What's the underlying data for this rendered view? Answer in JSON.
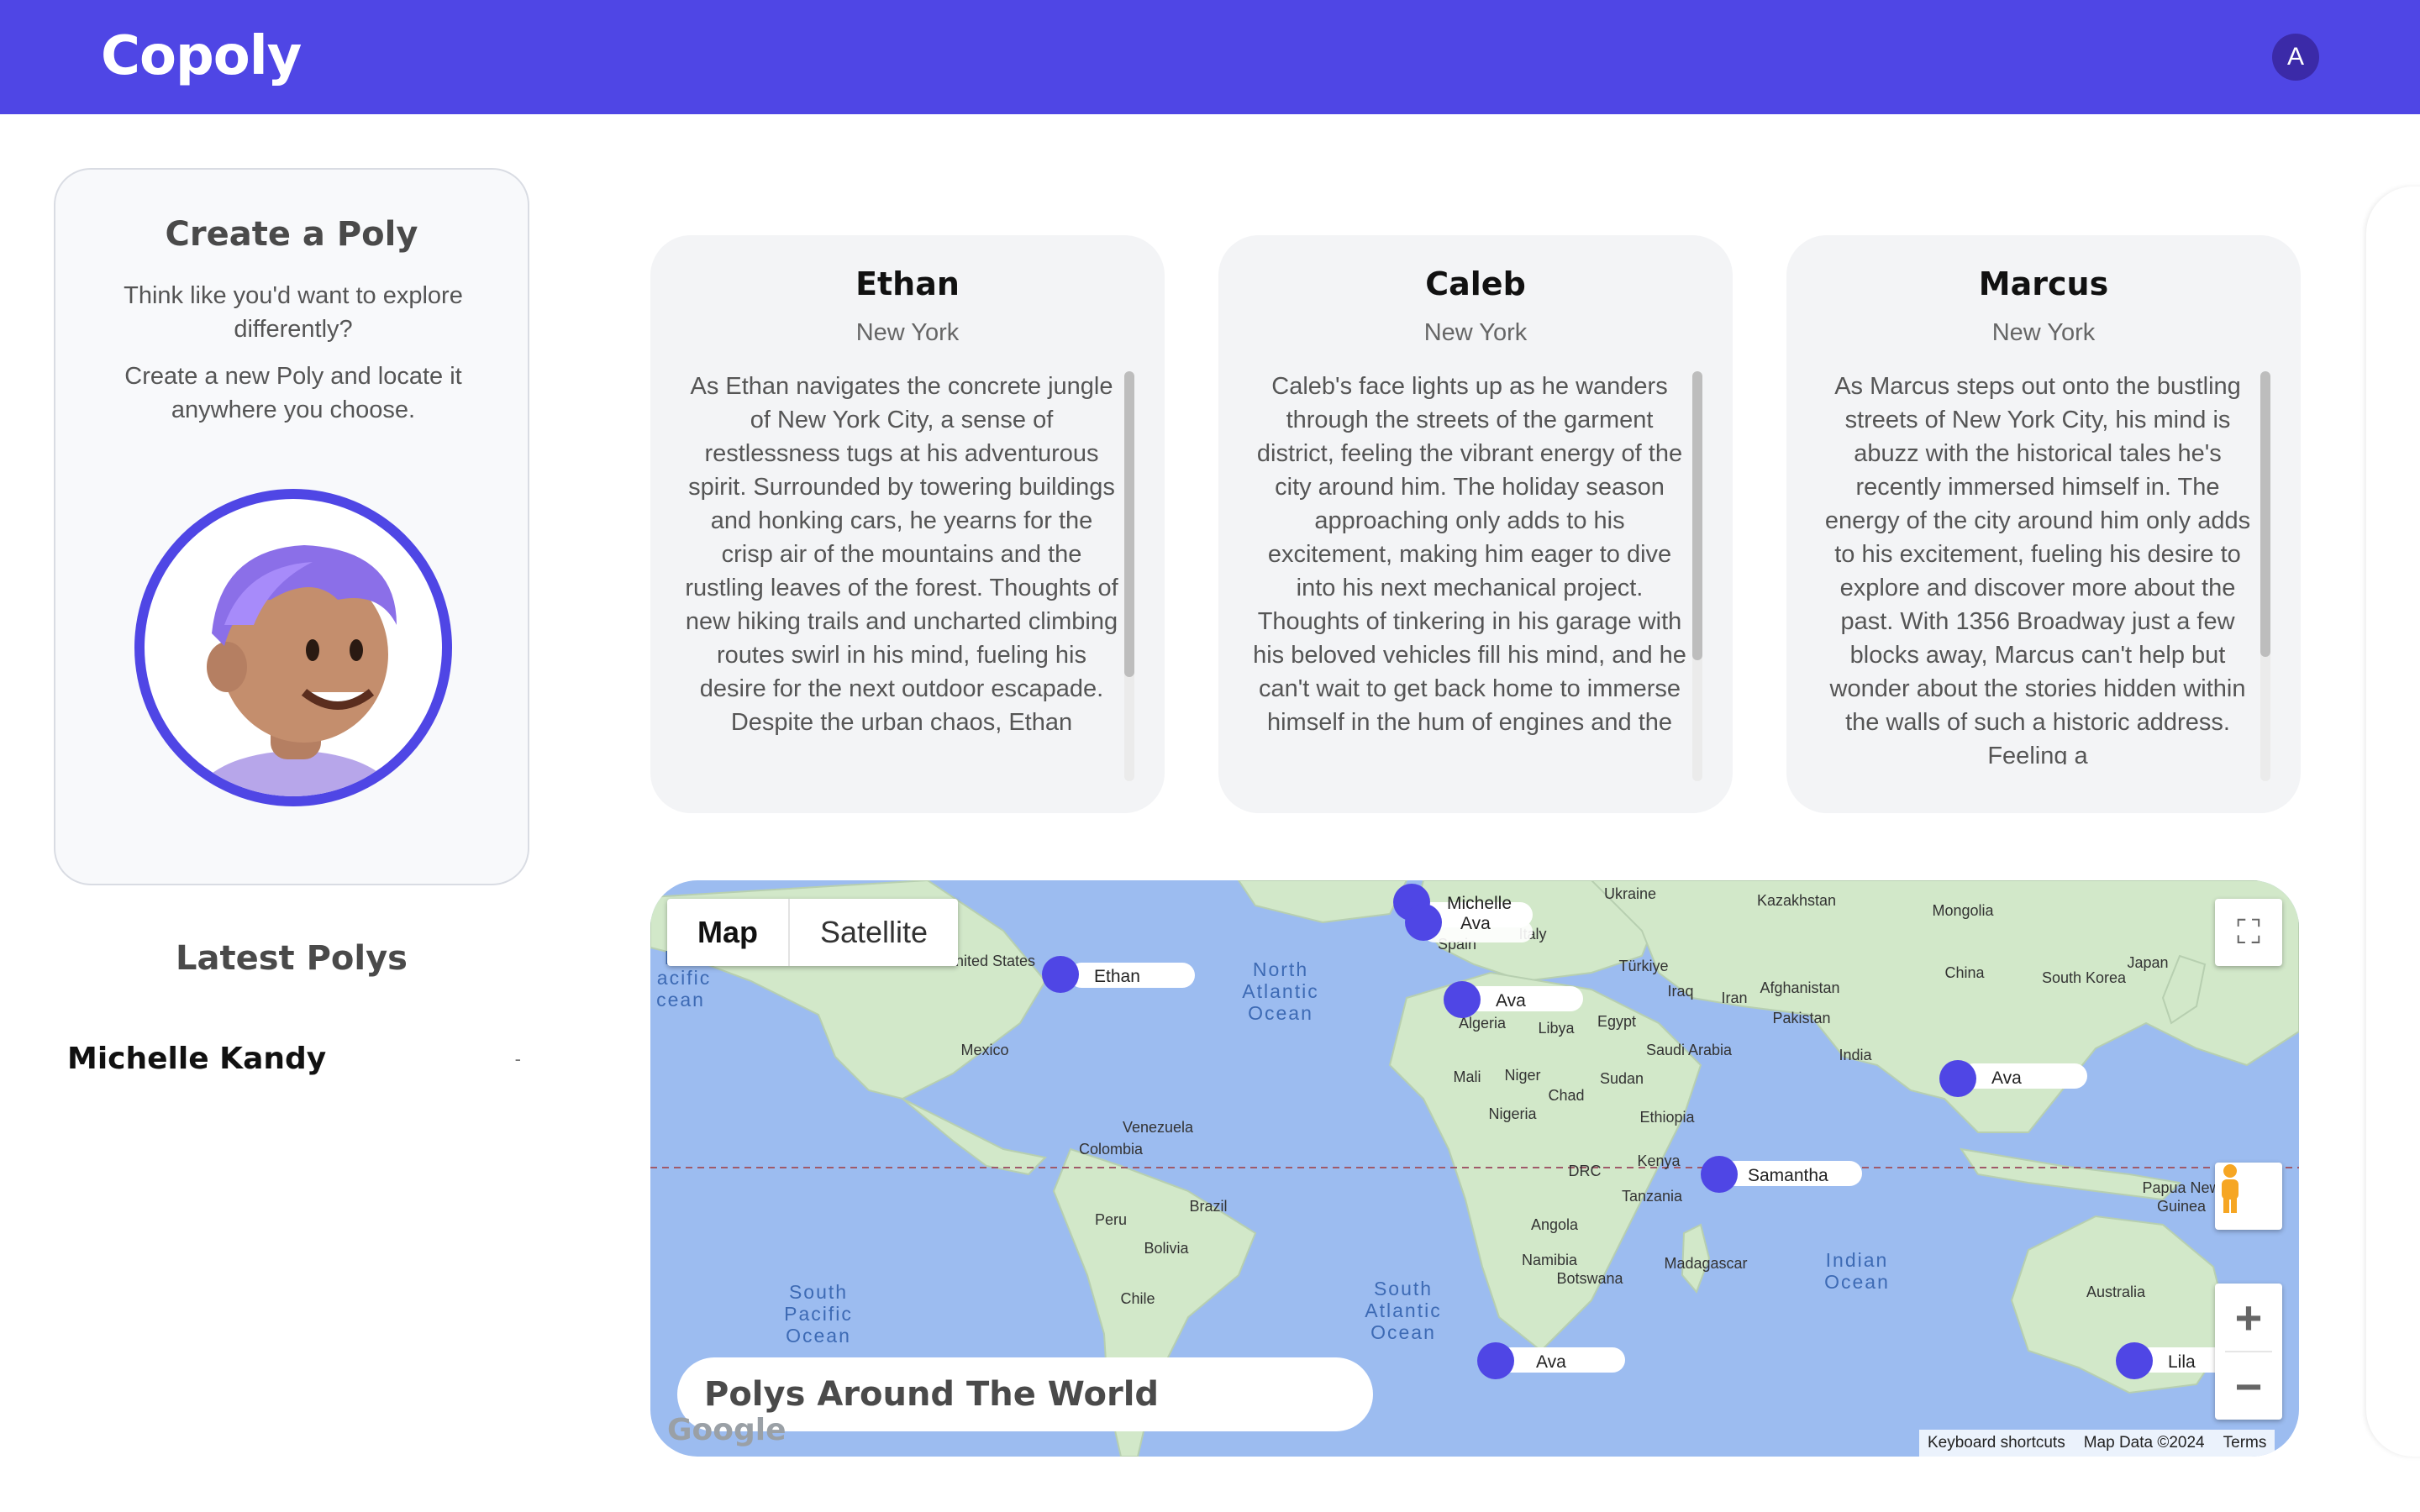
{
  "app": {
    "title": "Copoly",
    "user_initial": "A"
  },
  "create_poly": {
    "title": "Create a Poly",
    "text1": "Think like you'd want to explore differently?",
    "text2": "Create a new Poly and locate it anywhere you choose."
  },
  "latest": {
    "title": "Latest Polys",
    "items": [
      {
        "name": "Michelle Kandy",
        "meta": "-"
      }
    ]
  },
  "polys": [
    {
      "name": "Ethan",
      "city": "New York",
      "story": "As Ethan navigates the concrete jungle of New York City, a sense of restlessness tugs at his adventurous spirit. Surrounded by towering buildings and honking cars, he yearns for the crisp air of the mountains and the rustling leaves of the forest. Thoughts of new hiking trails and uncharted climbing routes swirl in his mind, fueling his desire for the next outdoor escapade. Despite the urban chaos, Ethan"
    },
    {
      "name": "Caleb",
      "city": "New York",
      "story": "Caleb's face lights up as he wanders through the streets of the garment district, feeling the vibrant energy of the city around him. The holiday season approaching only adds to his excitement, making him eager to dive into his next mechanical project. Thoughts of tinkering in his garage with his beloved vehicles fill his mind, and he can't wait to get back home to immerse himself in the hum of engines and the"
    },
    {
      "name": "Marcus",
      "city": "New York",
      "story": "As Marcus steps out onto the bustling streets of New York City, his mind is abuzz with the historical tales he's recently immersed himself in. The energy of the city around him only adds to his excitement, fueling his desire to explore and discover more about the past. With 1356 Broadway just a few blocks away, Marcus can't help but wonder about the stories hidden within the walls of such a historic address. Feeling a"
    }
  ],
  "map": {
    "type_map": "Map",
    "type_satellite": "Satellite",
    "title": "Polys Around The World",
    "footer_keyboard": "Keyboard shortcuts",
    "footer_data": "Map Data ©2024",
    "footer_terms": "Terms",
    "google": "Google",
    "markers": [
      "Michelle",
      "Ava",
      "Ethan",
      "Ava",
      "Ava",
      "Samantha",
      "Ava",
      "Lila"
    ],
    "labels": {
      "north_pacific": "N... Pacific Ocean",
      "north_atlantic": "North Atlantic Ocean",
      "south_pacific": "South Pacific Ocean",
      "south_atlantic": "South Atlantic Ocean",
      "indian": "Indian Ocean",
      "countries": [
        "United States",
        "Mexico",
        "Venezuela",
        "Colombia",
        "Brazil",
        "Peru",
        "Bolivia",
        "Chile",
        "Spain",
        "Italy",
        "Ukraine",
        "Kazakhstan",
        "Mongolia",
        "China",
        "South Korea",
        "Japan",
        "Türkiye",
        "Iraq",
        "Iran",
        "Afghanistan",
        "Pakistan",
        "India",
        "Algeria",
        "Libya",
        "Egypt",
        "Saudi Arabia",
        "Mali",
        "Niger",
        "Chad",
        "Sudan",
        "Nigeria",
        "Ethiopia",
        "Kenya",
        "DRC",
        "Tanzania",
        "Angola",
        "Namibia",
        "Botswana",
        "Madagascar",
        "Australia",
        "Papua New Guinea"
      ]
    }
  },
  "colors": {
    "brand": "#4f46e5",
    "marker": "#4f46e5",
    "water": "#9cbcf0",
    "land": "#cfe6c6"
  }
}
